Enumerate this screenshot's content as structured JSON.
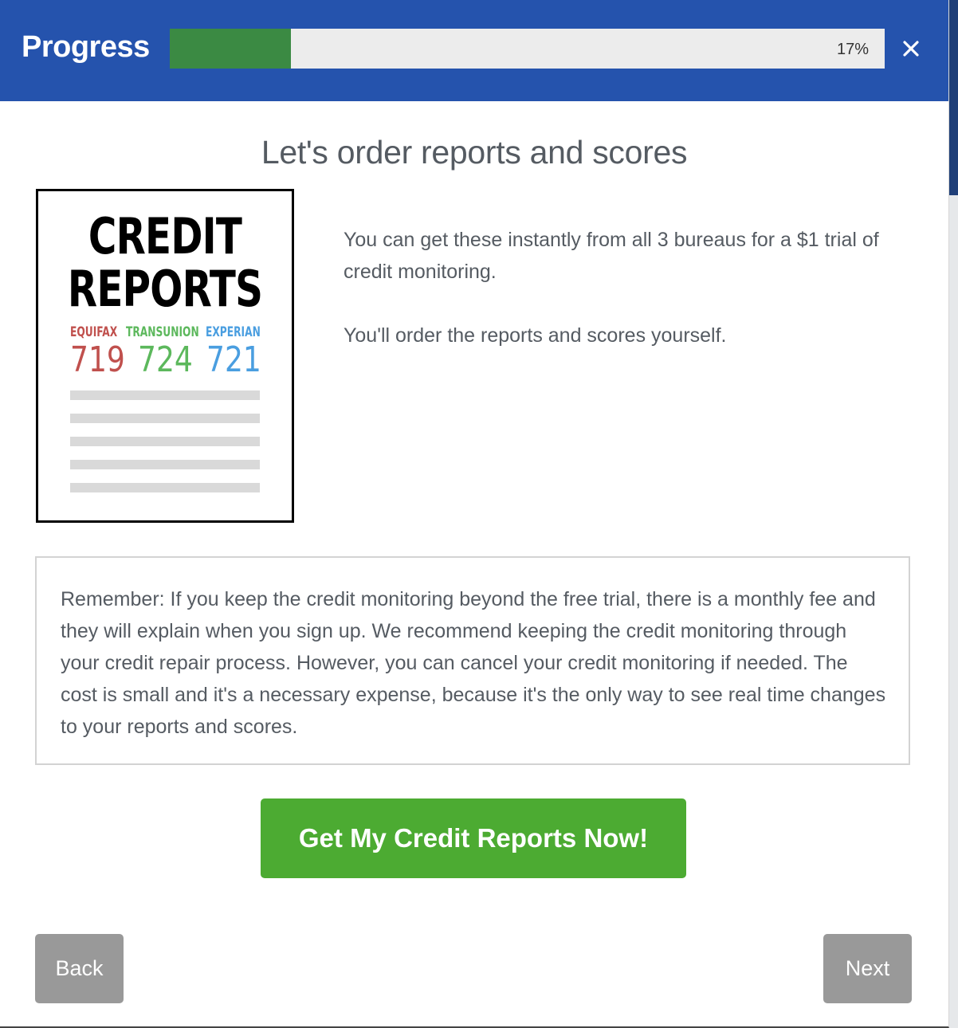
{
  "header": {
    "title": "Progress",
    "progress_fraction": 0.17,
    "progress_label": "17%",
    "close_icon": "close-icon",
    "bg_color": "#2553ad",
    "progress_color": "#3b8a43"
  },
  "main": {
    "heading": "Let's order reports and scores",
    "intro_line1": "You can get these instantly from all 3 bureaus for a $1 trial of credit monitoring.",
    "intro_line2": "You'll order the reports and scores yourself."
  },
  "illustration": {
    "title_line1": "CREDIT",
    "title_line2": "REPORTS",
    "bureaus": [
      {
        "name": "EQUIFAX",
        "score": "719",
        "color": "#c0504d"
      },
      {
        "name": "TRANSUNION",
        "score": "724",
        "color": "#5cb85c"
      },
      {
        "name": "EXPERIAN",
        "score": "721",
        "color": "#4a9ee0"
      }
    ]
  },
  "reminder": {
    "text": "Remember: If you keep the credit monitoring beyond the free trial, there is a monthly fee and they will explain when you sign up. We recommend keeping the credit monitoring through your credit repair process. However, you can cancel your credit monitoring if needed. The cost is small and it's a necessary expense, because it's the only way to see real time changes to your reports and scores."
  },
  "actions": {
    "cta_label": "Get My Credit Reports Now!",
    "cta_color": "#4cab32",
    "back_label": "Back",
    "next_label": "Next"
  }
}
